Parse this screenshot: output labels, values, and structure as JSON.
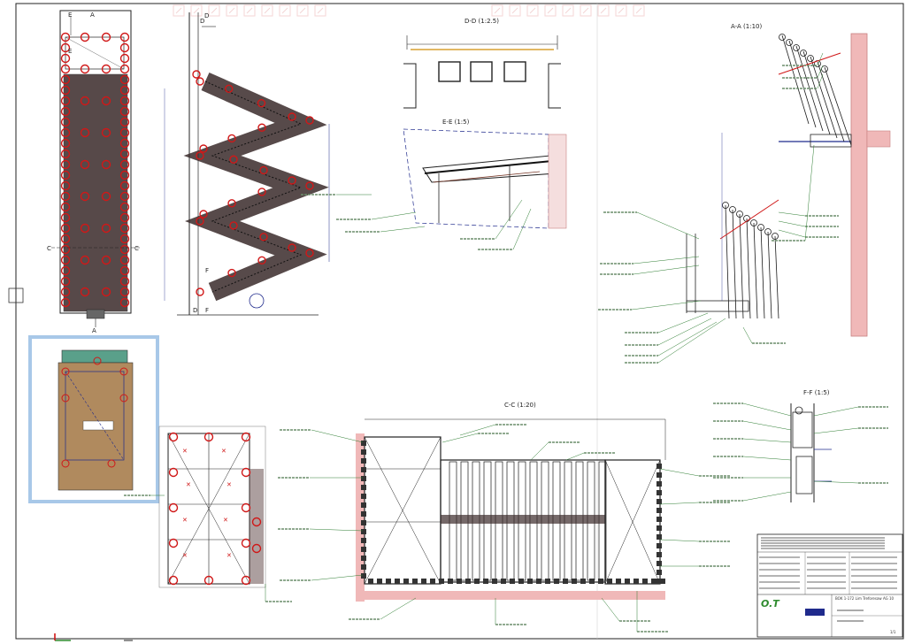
{
  "view_labels": {
    "section_d": "D-D (1:2.5)",
    "section_e": "E-E (1:5)",
    "section_a": "A-A (1:10)",
    "section_c": "C-C (1:20)",
    "section_f": "F-F (1:5)"
  },
  "cut_markers": {
    "a": "A",
    "c": "C",
    "d": "D",
    "e": "E",
    "f": "F"
  },
  "title_block": {
    "logo": "O.T",
    "project_line": "BOK 1-172 Lim Treforesaw AG 10",
    "sheet_no": "1/1"
  },
  "colors": {
    "line": "#1a1a1a",
    "bolt": "#d01818",
    "dimension": "#1f2a8c",
    "callout": "#2e7d32",
    "leader_text": "#6b8e6b",
    "wall_hatch": "#c98080",
    "wall_fill": "#f0b8b8",
    "plate_fill": "#b08a5e",
    "plate_top": "#5aa08a",
    "selection": "#a8c8e8",
    "toolbar_icon": "#e08a8a",
    "logo_green": "#2e8b2e"
  },
  "toolbar_icons": [
    "undo-icon",
    "redo-icon",
    "scissors-icon",
    "snap-icon",
    "measure-icon",
    "pencil-icon",
    "arc-icon",
    "view-front-icon",
    "view-top-icon",
    "view-side-icon",
    "zoom-icon",
    "zoom-window-icon",
    "iso-icon",
    "cube-icon",
    "layer-icon",
    "render-icon",
    "print-icon",
    "settings-icon"
  ]
}
